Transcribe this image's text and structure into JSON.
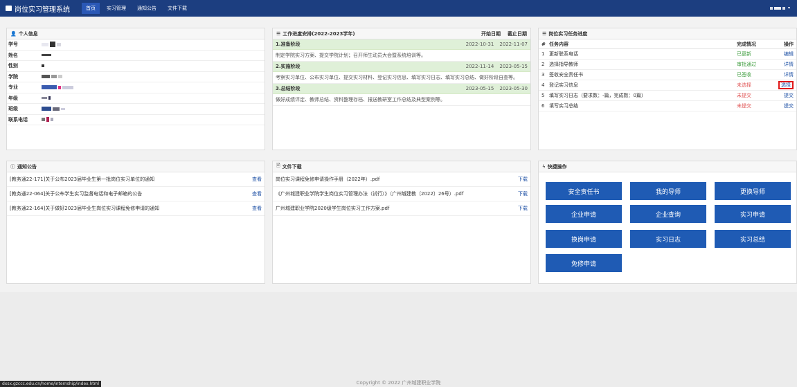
{
  "app": {
    "title": "岗位实习管理系统"
  },
  "nav": [
    {
      "label": "首页"
    },
    {
      "label": "实习管理"
    },
    {
      "label": "通知公告"
    },
    {
      "label": "文件下载"
    }
  ],
  "personal": {
    "title": "个人信息",
    "fields": [
      {
        "label": "学号"
      },
      {
        "label": "姓名"
      },
      {
        "label": "性别"
      },
      {
        "label": "学院"
      },
      {
        "label": "专业"
      },
      {
        "label": "年级"
      },
      {
        "label": "班级"
      },
      {
        "label": "联系电话"
      }
    ]
  },
  "schedule": {
    "title": "工作进度安排(2022-2023学年)",
    "col_start": "开始日期",
    "col_end": "截止日期",
    "stages": [
      {
        "title": "1.准备阶段",
        "start": "2022-10-31",
        "end": "2022-11-07",
        "desc": "制定学院实习方案、提交学院计划；召开师生动员大会暨系统培训等。"
      },
      {
        "title": "2.实施阶段",
        "start": "2022-11-14",
        "end": "2023-05-15",
        "desc": "考察实习单位、公布实习单位、提交实习材料、登记实习信息、填写实习日志、填写实习总结、做好阶段自查等。"
      },
      {
        "title": "3.总结阶段",
        "start": "2023-05-15",
        "end": "2023-05-30",
        "desc": "做好成绩评定、教师总结、资料整理存档、报送教研室工作总结及典型案例等。"
      }
    ]
  },
  "tasks": {
    "title": "岗位实习任务进度",
    "col_no": "#",
    "col_name": "任务内容",
    "col_status": "完成情况",
    "col_op": "操作",
    "rows": [
      {
        "no": "1",
        "name": "更新联系电话",
        "status": "已更新",
        "op": "编辑"
      },
      {
        "no": "2",
        "name": "选择指导教师",
        "status": "审批通过",
        "op": "详情"
      },
      {
        "no": "3",
        "name": "签收安全责任书",
        "status": "已签收",
        "op": "详情"
      },
      {
        "no": "4",
        "name": "登记实习信息",
        "status": "未选择",
        "op": "选择"
      },
      {
        "no": "5",
        "name": "填写实习日志（要求数：-篇，完成数：0篇）",
        "status": "未提交",
        "op": "提交"
      },
      {
        "no": "6",
        "name": "填写实习总结",
        "status": "未提交",
        "op": "提交"
      }
    ]
  },
  "notices": {
    "title": "通知公告",
    "items": [
      {
        "text": "[教务通22-171]关于公布2023届毕业生第一批岗位实习单位的通知",
        "action": "查看"
      },
      {
        "text": "[教务通22-064]关于公布学生实习监督电话和电子邮箱的公告",
        "action": "查看"
      },
      {
        "text": "[教务通22-164]关于做好2023届毕业生岗位实习课程免修申请的通知",
        "action": "查看"
      }
    ]
  },
  "files": {
    "title": "文件下载",
    "items": [
      {
        "text": "岗位实习课程免修申请操作手册（2022年）.pdf",
        "action": "下载"
      },
      {
        "text": "《广州城建职业学院学生岗位实习管理办法（试行）》（广州城建教〔2022〕26号）.pdf",
        "action": "下载"
      },
      {
        "text": "广州城建职业学院2020级学生岗位实习工作方案.pdf",
        "action": "下载"
      }
    ]
  },
  "quick": {
    "title": "快捷操作",
    "buttons": [
      {
        "label": "安全责任书"
      },
      {
        "label": "我的导师"
      },
      {
        "label": "更换导师"
      },
      {
        "label": "企业申请"
      },
      {
        "label": "企业查询"
      },
      {
        "label": "实习申请"
      },
      {
        "label": "换岗申请"
      },
      {
        "label": "实习日志"
      },
      {
        "label": "实习总结"
      },
      {
        "label": "免修申请"
      }
    ]
  },
  "footer": {
    "copyright": "Copyright © 2022 广州城建职业学院"
  },
  "status_bar": {
    "url": "dxsx.gzccc.edu.cn/home/internship/index.html"
  },
  "colors": {
    "nav_bg": "#1c3e80",
    "button": "#1f5bb4",
    "stage_bg": "#dff0d8",
    "status_ok": "#3c9c3c",
    "status_pending": "#e05656"
  }
}
